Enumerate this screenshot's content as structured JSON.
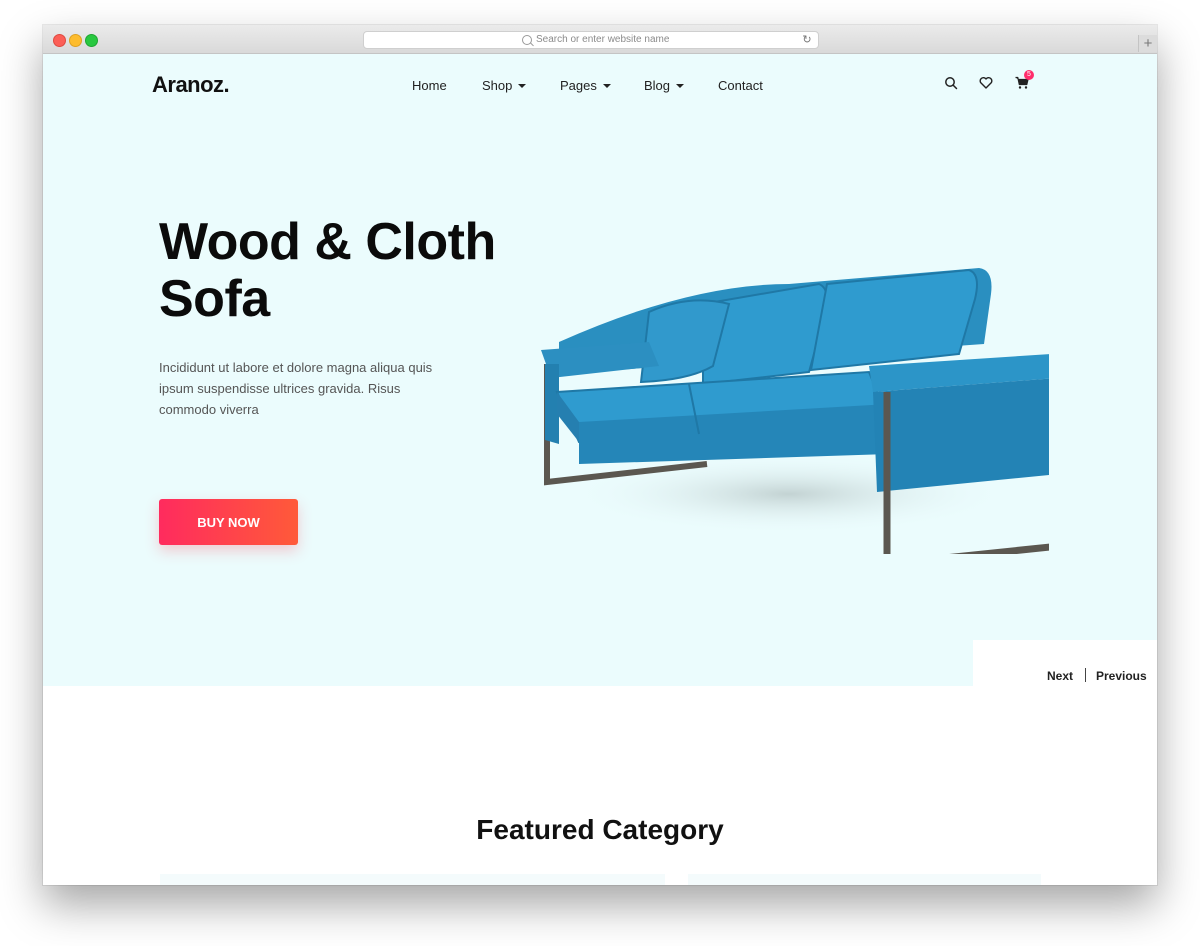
{
  "browser": {
    "url_placeholder": "Search or enter website name",
    "new_tab_label": "+"
  },
  "header": {
    "logo": "Aranoz.",
    "nav": [
      {
        "label": "Home",
        "has_dropdown": false
      },
      {
        "label": "Shop",
        "has_dropdown": true
      },
      {
        "label": "Pages",
        "has_dropdown": true
      },
      {
        "label": "Blog",
        "has_dropdown": true
      },
      {
        "label": "Contact",
        "has_dropdown": false
      }
    ],
    "icons": [
      "search-icon",
      "heart-icon",
      "cart-icon"
    ],
    "cart_count": "5"
  },
  "hero": {
    "title_line1": "Wood & Cloth",
    "title_line2": "Sofa",
    "description": "Incididunt ut labore et dolore magna aliqua quis ipsum suspendisse ultrices gravida. Risus commodo viverra",
    "button_label": "BUY NOW",
    "next_label": "Next",
    "previous_label": "Previous"
  },
  "featured": {
    "title": "Featured Category"
  },
  "colors": {
    "hero_bg": "#ebfcfd",
    "button_gradient_start": "#ff2b5e",
    "button_gradient_end": "#ff5a39",
    "sofa": "#2a8fc0",
    "badge": "#ff2d6b"
  }
}
